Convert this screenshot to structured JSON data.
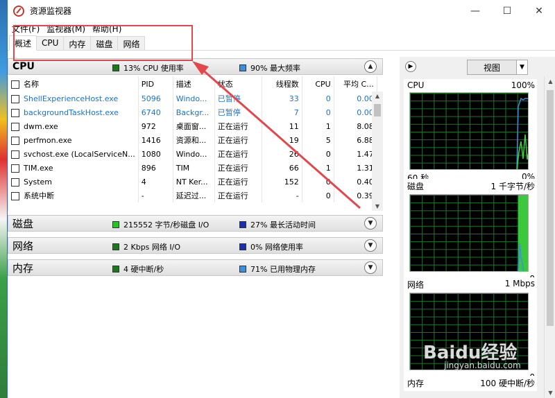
{
  "window": {
    "title": "资源监视器",
    "controls": [
      "—",
      "☐",
      "✕"
    ]
  },
  "menu": [
    "文件(F)",
    "监视器(M)",
    "帮助(H)"
  ],
  "tabs": [
    "概述",
    "CPU",
    "内存",
    "磁盘",
    "网络"
  ],
  "cpu": {
    "title": "CPU",
    "stat1": "13% CPU 使用率",
    "stat1_color": "#1a7a1a",
    "stat2": "90% 最大频率",
    "stat2_color": "#3b8fe0",
    "columns": [
      "名称",
      "PID",
      "描述",
      "状态",
      "线程数",
      "CPU",
      "平均 C..."
    ],
    "rows": [
      [
        "ShellExperienceHost.exe",
        "5096",
        "Windo...",
        "已暂停",
        "33",
        "0",
        "0.00"
      ],
      [
        "backgroundTaskHost.exe",
        "6740",
        "Backgr...",
        "已暂停",
        "7",
        "0",
        "0.00"
      ],
      [
        "dwm.exe",
        "972",
        "桌面窗...",
        "正在运行",
        "11",
        "1",
        "8.08"
      ],
      [
        "perfmon.exe",
        "1416",
        "资源和...",
        "正在运行",
        "19",
        "5",
        "6.88"
      ],
      [
        "svchost.exe (LocalServiceN...",
        "1080",
        "Windo...",
        "正在运行",
        "26",
        "0",
        "1.47"
      ],
      [
        "TIM.exe",
        "896",
        "TIM",
        "正在运行",
        "66",
        "1",
        "1.31"
      ],
      [
        "System",
        "4",
        "NT Ker...",
        "正在运行",
        "152",
        "0",
        "0.40"
      ],
      [
        "系统中断",
        "-",
        "延迟过...",
        "正在运行",
        "-",
        "0",
        "0.39"
      ]
    ]
  },
  "disk": {
    "title": "磁盘",
    "stat1": "215552 字节/秒磁盘 I/O",
    "stat1_color": "#1ec81e",
    "stat2": "27% 最长活动时间",
    "stat2_color": "#1a2fb0"
  },
  "network": {
    "title": "网络",
    "stat1": "2 Kbps 网络 I/O",
    "stat1_color": "#1a7a1a",
    "stat2": "0% 网络使用率",
    "stat2_color": "#1a2fb0"
  },
  "memory": {
    "title": "内存",
    "stat1": "4 硬中断/秒",
    "stat1_color": "#1a7a1a",
    "stat2": "71% 已用物理内存",
    "stat2_color": "#3b8fe0"
  },
  "right": {
    "view_label": "视图",
    "cpu_graph": {
      "label": "CPU",
      "max": "100%",
      "time": "60 秒",
      "min": "0%"
    },
    "disk_graph": {
      "label": "磁盘",
      "max": "1 千字节/秒",
      "min": "0"
    },
    "net_graph": {
      "label": "网络",
      "max": "1 Mbps",
      "min": "0"
    },
    "mem_graph": {
      "label": "内存",
      "max": "100 硬中断/秒"
    }
  },
  "watermark": {
    "text": "Baidu经验",
    "sub": "jingyan.baidu.com"
  }
}
